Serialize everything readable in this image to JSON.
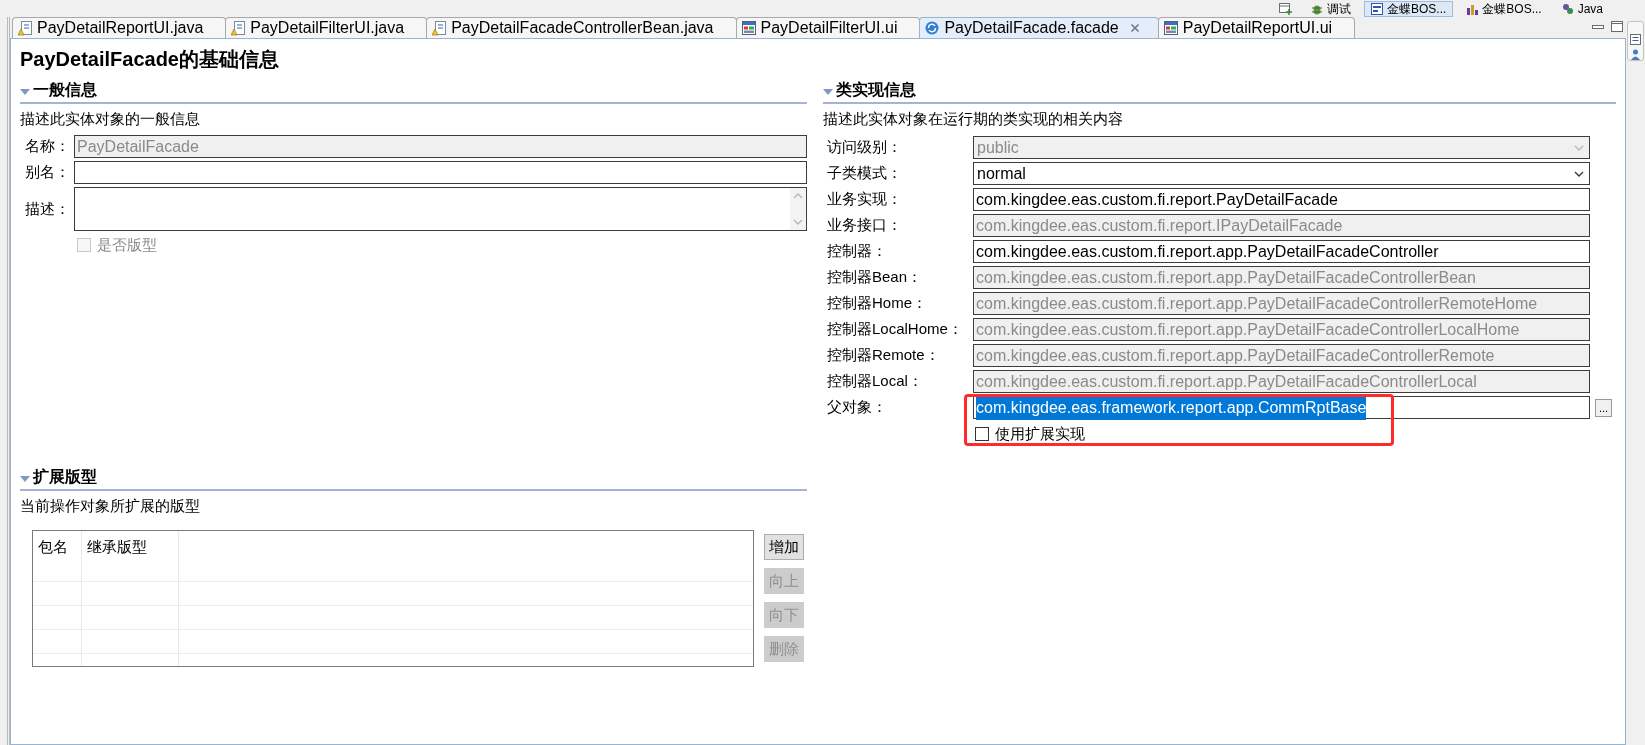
{
  "perspective_bar": {
    "items": [
      {
        "label": "调试",
        "kind": "debug",
        "selected": false
      },
      {
        "label": "金蝶BOS...",
        "kind": "bos",
        "selected": true
      },
      {
        "label": "金蝶BOS...",
        "kind": "bos_report",
        "selected": false
      },
      {
        "label": "Java",
        "kind": "java",
        "selected": false
      }
    ]
  },
  "editor_tabs": [
    {
      "label": "PayDetailReportUI.java",
      "kind": "java",
      "selected": false
    },
    {
      "label": "PayDetailFilterUI.java",
      "kind": "java",
      "selected": false
    },
    {
      "label": "PayDetailFacadeControllerBean.java",
      "kind": "java",
      "selected": false
    },
    {
      "label": "PayDetailFilterUI.ui",
      "kind": "ui",
      "selected": false
    },
    {
      "label": "PayDetailFacade.facade",
      "kind": "facade",
      "selected": true
    },
    {
      "label": "PayDetailReportUI.ui",
      "kind": "ui",
      "selected": false
    }
  ],
  "editor": {
    "title": "PayDetailFacade的基础信息",
    "general_section": {
      "heading": "一般信息",
      "expanded": true,
      "description": "描述此实体对象的一般信息",
      "fields": [
        {
          "label": "名称：",
          "kind": "text",
          "value": "PayDetailFacade",
          "disabled": true
        },
        {
          "label": "别名：",
          "kind": "text",
          "disabled": false
        },
        {
          "label": "描述：",
          "kind": "textarea",
          "disabled": false
        }
      ],
      "checkbox": {
        "label": "是否版型",
        "checked": false,
        "disabled": true
      }
    },
    "class_section": {
      "heading": "类实现信息",
      "expanded": true,
      "description": "描述此实体对象在运行期的类实现的相关内容",
      "fields": [
        {
          "label": "访问级别：",
          "kind": "select",
          "value": "public",
          "disabled": true
        },
        {
          "label": "子类模式：",
          "kind": "select",
          "value": "normal",
          "disabled": false
        },
        {
          "label": "业务实现：",
          "kind": "text",
          "value": "com.kingdee.eas.custom.fi.report.PayDetailFacade",
          "disabled": false
        },
        {
          "label": "业务接口：",
          "kind": "text",
          "value": "com.kingdee.eas.custom.fi.report.IPayDetailFacade",
          "disabled": true
        },
        {
          "label": "控制器：",
          "kind": "text",
          "value": "com.kingdee.eas.custom.fi.report.app.PayDetailFacadeController",
          "disabled": false
        },
        {
          "label": "控制器Bean：",
          "kind": "text",
          "value": "com.kingdee.eas.custom.fi.report.app.PayDetailFacadeControllerBean",
          "disabled": true
        },
        {
          "label": "控制器Home：",
          "kind": "text",
          "value": "com.kingdee.eas.custom.fi.report.app.PayDetailFacadeControllerRemoteHome",
          "disabled": true
        },
        {
          "label": "控制器LocalHome：",
          "kind": "text",
          "value": "com.kingdee.eas.custom.fi.report.app.PayDetailFacadeControllerLocalHome",
          "disabled": true
        },
        {
          "label": "控制器Remote：",
          "kind": "text",
          "value": "com.kingdee.eas.custom.fi.report.app.PayDetailFacadeControllerRemote",
          "disabled": true
        },
        {
          "label": "控制器Local：",
          "kind": "text",
          "value": "com.kingdee.eas.custom.fi.report.app.PayDetailFacadeControllerLocal",
          "disabled": true
        },
        {
          "label": "父对象：",
          "kind": "browse",
          "value": "com.kingdee.eas.framework.report.app.CommRptBase",
          "disabled": false,
          "text_selected": true,
          "highlighted": true,
          "button_label": "..."
        }
      ],
      "checkbox": {
        "label": "使用扩展实现",
        "checked": false,
        "disabled": false
      }
    },
    "extension_section": {
      "heading": "扩展版型",
      "expanded": true,
      "description": "当前操作对象所扩展的版型",
      "table": {
        "columns": [
          "包名",
          "继承版型"
        ]
      },
      "buttons": [
        {
          "label": "增加",
          "disabled": false
        },
        {
          "label": "向上",
          "disabled": true
        },
        {
          "label": "向下",
          "disabled": true
        },
        {
          "label": "删除",
          "disabled": true
        }
      ]
    }
  }
}
